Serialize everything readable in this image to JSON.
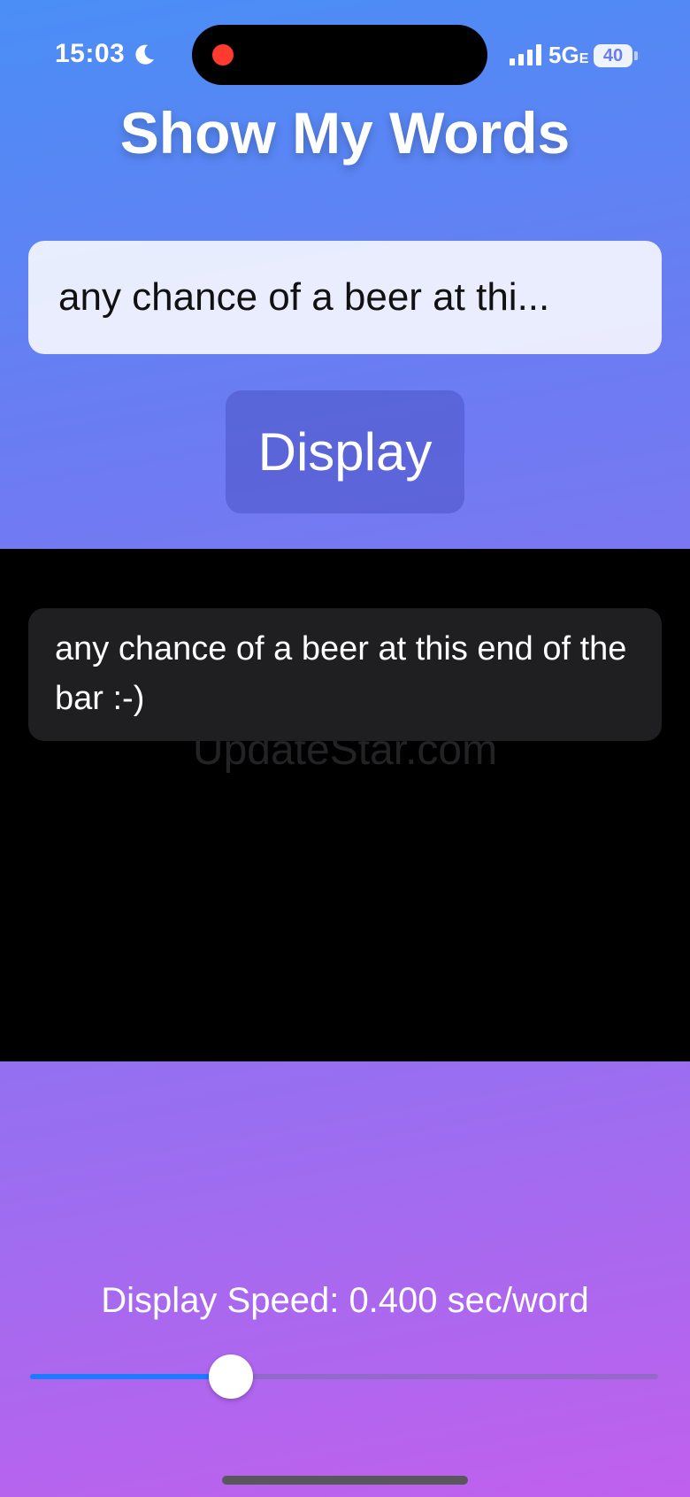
{
  "status_bar": {
    "time": "15:03",
    "focus_icon": "moon-icon",
    "recording_indicator": "red-dot",
    "network": "5G",
    "network_suffix": "E",
    "battery": "40"
  },
  "app": {
    "title": "Show My Words"
  },
  "input": {
    "value": "any chance of a beer at this end of the bar :-)",
    "display_text": "any chance of a beer at thi..."
  },
  "display_button": {
    "label": "Display"
  },
  "display_area": {
    "output_text": "any chance of a beer at this end of the bar :-)",
    "watermark": "UpdateStar.com"
  },
  "speed": {
    "label": "Display Speed: 0.400 sec/word",
    "slider_fraction": 0.32
  },
  "colors": {
    "accent": "#1e7bff",
    "recording_dot": "#ff3b30",
    "display_background": "#000000"
  }
}
